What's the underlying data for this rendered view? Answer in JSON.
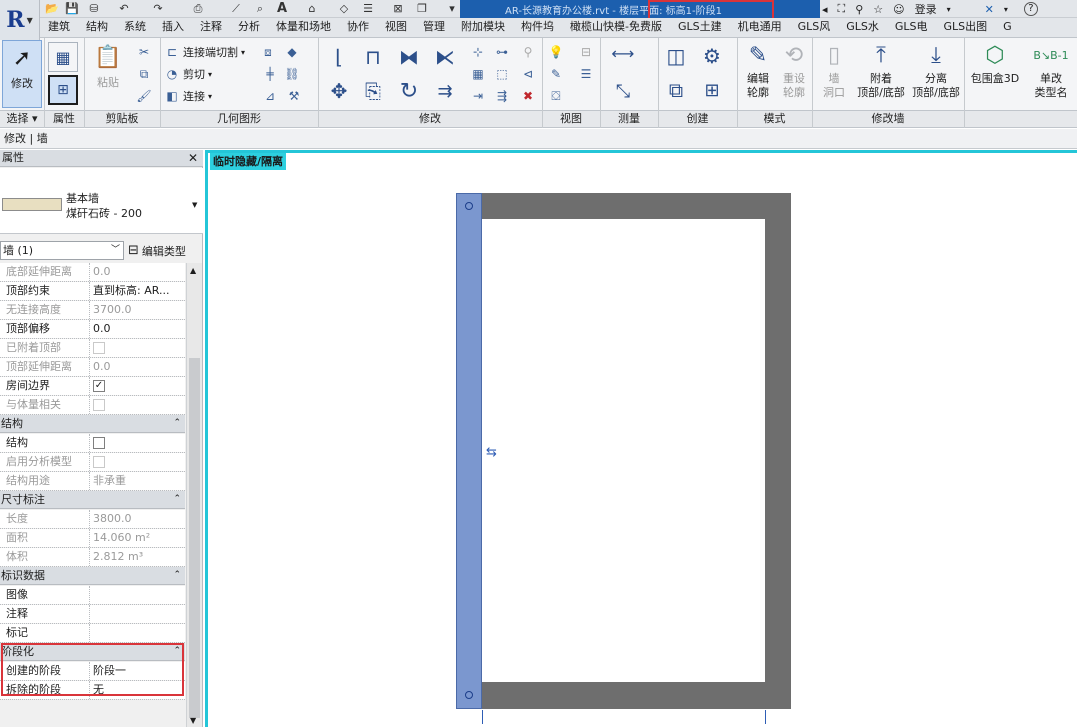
{
  "qat": {
    "title": "AR-长源教育办公楼.rvt - 楼层平面: 标高1-阶段1",
    "login": "登录",
    "help": "?"
  },
  "tabs": [
    "建筑",
    "结构",
    "系统",
    "插入",
    "注释",
    "分析",
    "体量和场地",
    "协作",
    "视图",
    "管理",
    "附加模块",
    "构件坞",
    "橄榄山快模-免费版",
    "GLS土建",
    "机电通用",
    "GLS风",
    "GLS水",
    "GLS电",
    "GLS出图",
    "G"
  ],
  "ribbon": {
    "modify_label": "修改",
    "paste_label": "粘贴",
    "cut_join": "连接端切割",
    "cut": "剪切",
    "join": "连接",
    "edit_profile": "编辑\n轮廓",
    "reset_profile": "重设\n轮廓",
    "wall_opening": "墙\n洞口",
    "attach": "附着\n顶部/底部",
    "detach": "分离\n顶部/底部",
    "bbox3d": "包围盒3D",
    "single_change": "单改\n类型名",
    "panels": [
      "选择 ▾",
      "属性",
      "剪贴板",
      "几何图形",
      "修改",
      "视图",
      "测量",
      "创建",
      "模式",
      "修改墙"
    ]
  },
  "context": "修改 | 墙",
  "properties": {
    "title": "属性",
    "type_name": "基本墙",
    "type_sub": "煤矸石砖 - 200",
    "instance": "墙 (1)",
    "edit_type": "编辑类型",
    "rows": [
      {
        "k": "底部延伸距离",
        "v": "0.0",
        "dis": true
      },
      {
        "k": "顶部约束",
        "v": "直到标高: AR...",
        "dis": false
      },
      {
        "k": "无连接高度",
        "v": "3700.0",
        "dis": true
      },
      {
        "k": "顶部偏移",
        "v": "0.0",
        "dis": false
      },
      {
        "k": "已附着顶部",
        "v": "",
        "chk": "empty-dis",
        "dis": true
      },
      {
        "k": "顶部延伸距离",
        "v": "0.0",
        "dis": true
      },
      {
        "k": "房间边界",
        "v": "✓",
        "chk": "checked",
        "dis": false
      },
      {
        "k": "与体量相关",
        "v": "",
        "chk": "empty-dis",
        "dis": true
      }
    ],
    "groups": {
      "structure": "结构",
      "dims": "尺寸标注",
      "identity": "标识数据",
      "phasing": "阶段化"
    },
    "structure_rows": [
      {
        "k": "结构",
        "v": "",
        "chk": "empty",
        "dis": false
      },
      {
        "k": "启用分析模型",
        "v": "",
        "chk": "empty-dis",
        "dis": true
      },
      {
        "k": "结构用途",
        "v": "非承重",
        "dis": true
      }
    ],
    "dims_rows": [
      {
        "k": "长度",
        "v": "3800.0",
        "dis": true
      },
      {
        "k": "面积",
        "v": "14.060 m²",
        "dis": true
      },
      {
        "k": "体积",
        "v": "2.812 m³",
        "dis": true
      }
    ],
    "identity_rows": [
      {
        "k": "图像",
        "v": ""
      },
      {
        "k": "注释",
        "v": ""
      },
      {
        "k": "标记",
        "v": ""
      }
    ],
    "phasing_rows": [
      {
        "k": "创建的阶段",
        "v": "阶段一"
      },
      {
        "k": "拆除的阶段",
        "v": "无"
      }
    ]
  },
  "canvas": {
    "temp_label": "临时隐藏/隔离"
  },
  "colors": {
    "title_bar": "#1c5fae",
    "highlight_red": "#d9343a",
    "view_border": "#24c6d8",
    "wall_gray": "#6e6e6e",
    "wall_selected": "#7b97cf"
  }
}
